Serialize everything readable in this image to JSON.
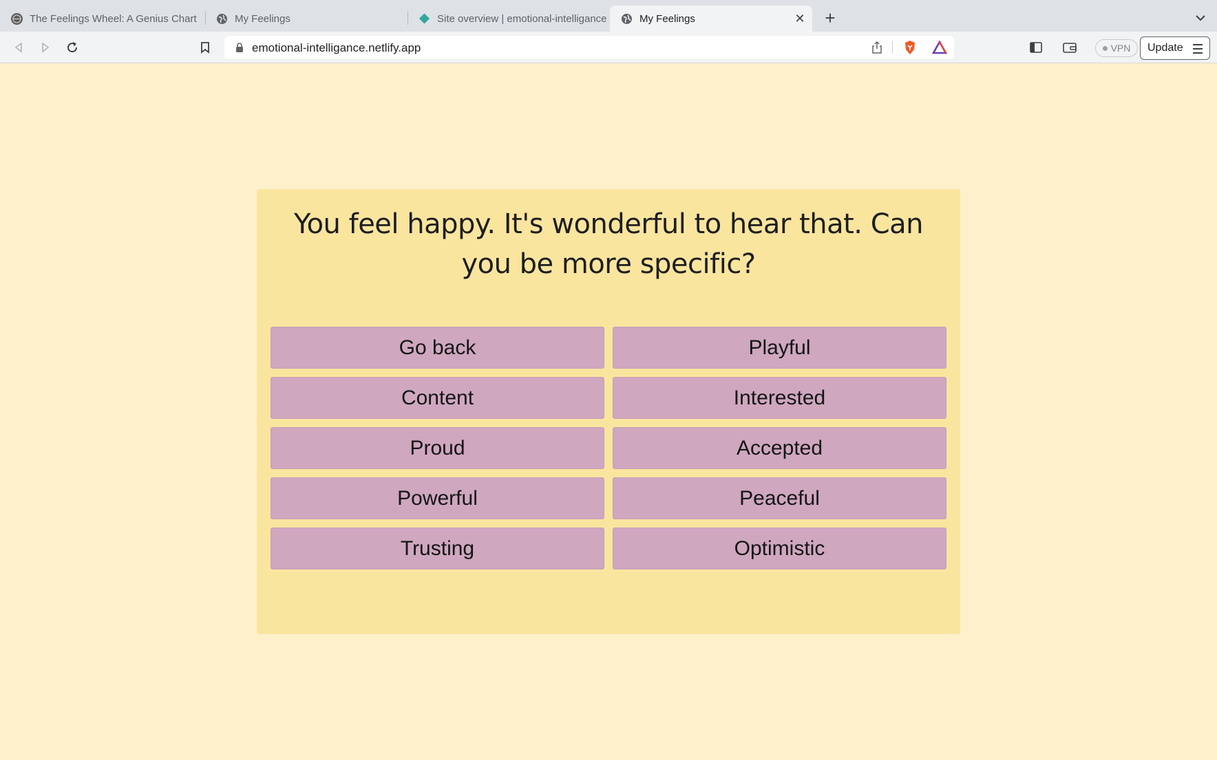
{
  "browser": {
    "tabs": [
      {
        "title": "The Feelings Wheel: A Genius Chart",
        "favicon": "site-globe-dark-icon",
        "active": false
      },
      {
        "title": "My Feelings",
        "favicon": "globe-icon",
        "active": false
      },
      {
        "title": "Site overview | emotional-intelligance",
        "favicon": "netlify-diamond-icon",
        "active": false
      },
      {
        "title": "My Feelings",
        "favicon": "globe-icon",
        "active": true
      }
    ],
    "address": "emotional-intelligance.netlify.app",
    "vpn_label": "VPN",
    "update_label": "Update"
  },
  "page": {
    "question": "You feel happy. It's wonderful to hear that. Can you be more specific?",
    "options": [
      "Go back",
      "Playful",
      "Content",
      "Interested",
      "Proud",
      "Accepted",
      "Powerful",
      "Peaceful",
      "Trusting",
      "Optimistic"
    ]
  },
  "colors": {
    "page_background": "#fff0cc",
    "card_background": "#fae59f",
    "button_background": "#cfa7bf"
  }
}
